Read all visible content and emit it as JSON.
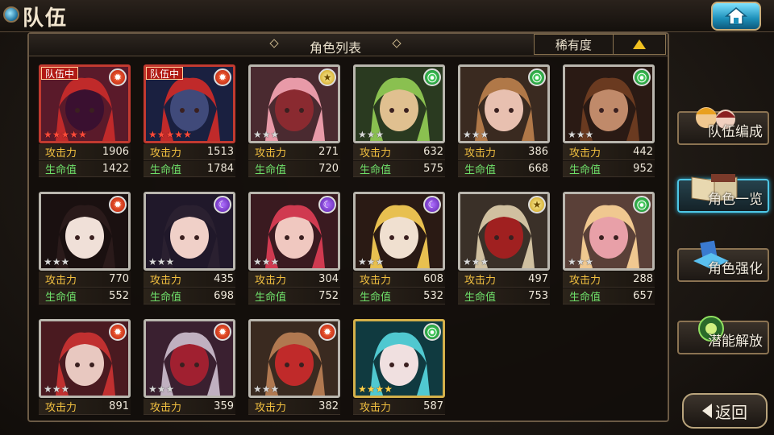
{
  "header": {
    "title": "队伍"
  },
  "list": {
    "title": "角色列表",
    "sort_label": "稀有度",
    "atk_label": "攻击力",
    "hp_label": "生命值",
    "in_team_label": "队伍中"
  },
  "menu": {
    "team_edit": "队伍编成",
    "char_list": "角色一览",
    "char_enhance": "角色强化",
    "potential": "潜能解放",
    "back": "返回"
  },
  "characters": [
    {
      "atk": "1906",
      "hp": "1422",
      "element": "fire",
      "stars": 5,
      "in_team": true,
      "colors": [
        "#5a1a2a",
        "#c02a2a",
        "#3a1030"
      ]
    },
    {
      "atk": "1513",
      "hp": "1784",
      "element": "fire",
      "stars": 5,
      "in_team": true,
      "colors": [
        "#1a2040",
        "#c02a2a",
        "#404a7a"
      ]
    },
    {
      "atk": "271",
      "hp": "720",
      "element": "light",
      "stars": 3,
      "in_team": false,
      "colors": [
        "#4a2a30",
        "#e89aa8",
        "#8a2a30"
      ]
    },
    {
      "atk": "632",
      "hp": "575",
      "element": "wind",
      "stars": 3,
      "in_team": false,
      "colors": [
        "#2a3a20",
        "#8ac050",
        "#e0c090"
      ]
    },
    {
      "atk": "386",
      "hp": "668",
      "element": "wind",
      "stars": 3,
      "in_team": false,
      "colors": [
        "#3a2a20",
        "#b07848",
        "#e8c0b0"
      ]
    },
    {
      "atk": "442",
      "hp": "952",
      "element": "wind",
      "stars": 3,
      "in_team": false,
      "colors": [
        "#2a1a14",
        "#6a3a20",
        "#c08a6a"
      ]
    },
    {
      "atk": "770",
      "hp": "552",
      "element": "fire",
      "stars": 3,
      "in_team": false,
      "colors": [
        "#1a1010",
        "#2a1a1a",
        "#f0e0d8"
      ]
    },
    {
      "atk": "435",
      "hp": "698",
      "element": "moon",
      "stars": 3,
      "in_team": false,
      "colors": [
        "#20182a",
        "#2a2030",
        "#f0d0c8"
      ]
    },
    {
      "atk": "304",
      "hp": "752",
      "element": "moon",
      "stars": 3,
      "in_team": false,
      "colors": [
        "#3a1a20",
        "#d03a50",
        "#f0c8c0"
      ]
    },
    {
      "atk": "608",
      "hp": "532",
      "element": "moon",
      "stars": 3,
      "in_team": false,
      "colors": [
        "#2a1a14",
        "#e8c050",
        "#f0e0d0"
      ]
    },
    {
      "atk": "497",
      "hp": "753",
      "element": "light",
      "stars": 3,
      "in_team": false,
      "colors": [
        "#3a3028",
        "#d0c0a0",
        "#a02020"
      ]
    },
    {
      "atk": "288",
      "hp": "657",
      "element": "wind",
      "stars": 3,
      "in_team": false,
      "colors": [
        "#5a4038",
        "#f0c890",
        "#e8a0a8"
      ]
    },
    {
      "atk": "891",
      "hp": "",
      "element": "fire",
      "stars": 3,
      "in_team": false,
      "colors": [
        "#4a1a20",
        "#c03030",
        "#e8c8c0"
      ]
    },
    {
      "atk": "359",
      "hp": "",
      "element": "fire",
      "stars": 3,
      "in_team": false,
      "colors": [
        "#3a2030",
        "#c0b0c0",
        "#a02030"
      ]
    },
    {
      "atk": "382",
      "hp": "",
      "element": "fire",
      "stars": 3,
      "in_team": false,
      "colors": [
        "#3a2a20",
        "#b07850",
        "#c02a2a"
      ]
    },
    {
      "atk": "587",
      "hp": "",
      "element": "wind",
      "stars": 4,
      "in_team": false,
      "colors": [
        "#103a40",
        "#50c8d0",
        "#f0e0e0"
      ]
    }
  ]
}
